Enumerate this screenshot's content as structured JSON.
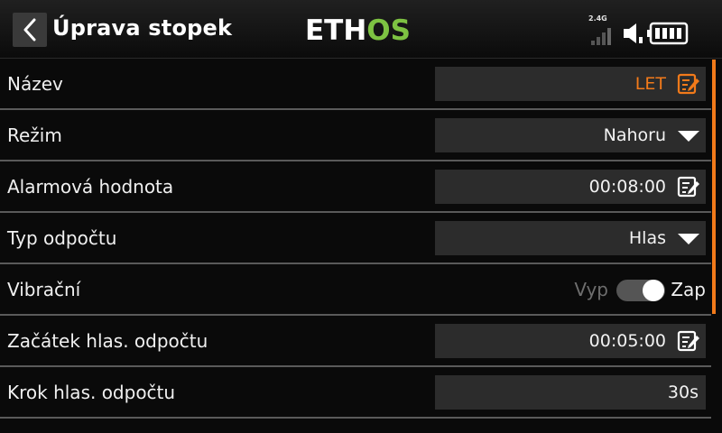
{
  "header": {
    "title": "Úprava stopek",
    "logo_main": "ETH",
    "logo_accent": "OS",
    "rf_label": "2.4G"
  },
  "colors": {
    "accent": "#f27a1a",
    "logo_green": "#7dc242",
    "field_bg": "#2c2c2c"
  },
  "rows": [
    {
      "label": "Název",
      "value": "LET",
      "icon": "edit-icon",
      "value_color": "accent"
    },
    {
      "label": "Režim",
      "value": "Nahoru",
      "icon": "dropdown-arrow-icon"
    },
    {
      "label": "Alarmová hodnota",
      "value": "00:08:00",
      "icon": "edit-icon"
    },
    {
      "label": "Typ odpočtu",
      "value": "Hlas",
      "icon": "dropdown-arrow-icon"
    },
    {
      "label": "Vibrační",
      "off_label": "Vyp",
      "on_label": "Zap",
      "state": "on"
    },
    {
      "label": "Začátek hlas. odpočtu",
      "value": "00:05:00",
      "icon": "edit-icon"
    },
    {
      "label": "Krok hlas. odpočtu",
      "value": "30s"
    }
  ]
}
